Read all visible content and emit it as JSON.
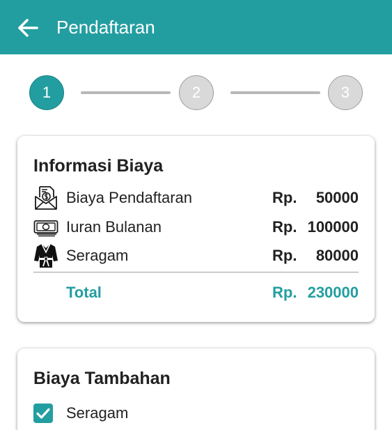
{
  "appbar": {
    "title": "Pendaftaran",
    "back_icon": "arrow-left-icon",
    "background": "#239ea0"
  },
  "stepper": {
    "steps": [
      {
        "label": "1",
        "state": "active"
      },
      {
        "label": "2",
        "state": "inactive"
      },
      {
        "label": "3",
        "state": "inactive"
      }
    ]
  },
  "fee_info": {
    "title": "Informasi Biaya",
    "items": [
      {
        "label": "Biaya Pendaftaran",
        "currency": "Rp.",
        "amount": "50000",
        "icon": "invoice-envelope-icon"
      },
      {
        "label": "Iuran Bulanan",
        "currency": "Rp.",
        "amount": "100000",
        "icon": "banknote-icon"
      },
      {
        "label": "Seragam",
        "currency": "Rp.",
        "amount": "80000",
        "icon": "martial-arts-uniform-icon"
      }
    ],
    "total": {
      "label": "Total",
      "currency": "Rp.",
      "amount": "230000"
    }
  },
  "extra_fees": {
    "title": "Biaya Tambahan",
    "options": [
      {
        "label": "Seragam",
        "checked": true
      }
    ]
  },
  "colors": {
    "accent": "#239ea0",
    "text": "#212121",
    "step_inactive": "#d9d9d9"
  }
}
